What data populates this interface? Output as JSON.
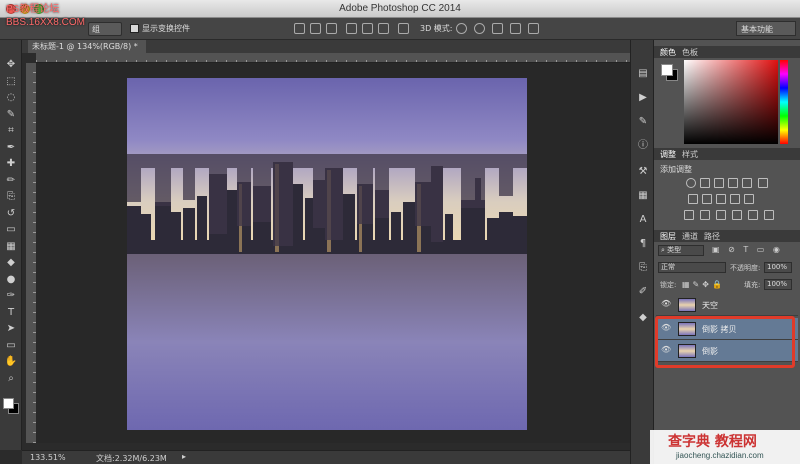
{
  "window": {
    "title": "Adobe Photoshop CC 2014"
  },
  "watermark_top": {
    "line1": "PS教程论坛",
    "line2": "BBS.16XX8.COM"
  },
  "options_bar": {
    "auto_select_value": "组",
    "show_transform_label": "显示变换控件",
    "mode_3d_label": "3D 模式:",
    "workspace": "基本功能"
  },
  "document_tab": {
    "label": "未标题-1 @ 134%(RGB/8) *"
  },
  "status_bar": {
    "zoom": "133.51%",
    "doc_size": "文档:2.32M/6.23M"
  },
  "panels": {
    "color": {
      "tabs": [
        "颜色",
        "色板"
      ]
    },
    "adjustments": {
      "tabs": [
        "调整",
        "样式"
      ],
      "add_label": "添加调整"
    },
    "layers": {
      "tabs": [
        "图层",
        "通道",
        "路径"
      ],
      "filter_kind": "类型",
      "blend_mode": "正常",
      "opacity_label": "不透明度:",
      "opacity_value": "100%",
      "lock_label": "锁定:",
      "fill_label": "填充:",
      "fill_value": "100%",
      "items": [
        {
          "name": "天空",
          "selected": false
        },
        {
          "name": "倒影 拷贝",
          "selected": true
        },
        {
          "name": "倒影",
          "selected": true
        }
      ]
    }
  },
  "watermark_bottom": {
    "main": "查字典 教程网",
    "sub": "jiaocheng.chazidian.com"
  },
  "icons": {
    "toolbar": [
      "move-icon",
      "marquee-icon",
      "lasso-icon",
      "quick-select-icon",
      "crop-icon",
      "eyedropper-icon",
      "healing-icon",
      "brush-icon",
      "clone-stamp-icon",
      "history-brush-icon",
      "eraser-icon",
      "gradient-icon",
      "blur-icon",
      "dodge-icon",
      "pen-icon",
      "type-icon",
      "path-select-icon",
      "shape-icon",
      "hand-icon",
      "zoom-icon"
    ],
    "glyphs": [
      "✥",
      "⬚",
      "◌",
      "✎",
      "⌗",
      "✒",
      "✚",
      "✏",
      "⎘",
      "↺",
      "▭",
      "▦",
      "◆",
      "●",
      "✑",
      "T",
      "➤",
      "▭",
      "✋",
      "⌕"
    ]
  },
  "colors": {
    "selection": "#647a95",
    "highlight": "#e03b2a",
    "foreground": "#ffffff",
    "background": "#000000"
  }
}
